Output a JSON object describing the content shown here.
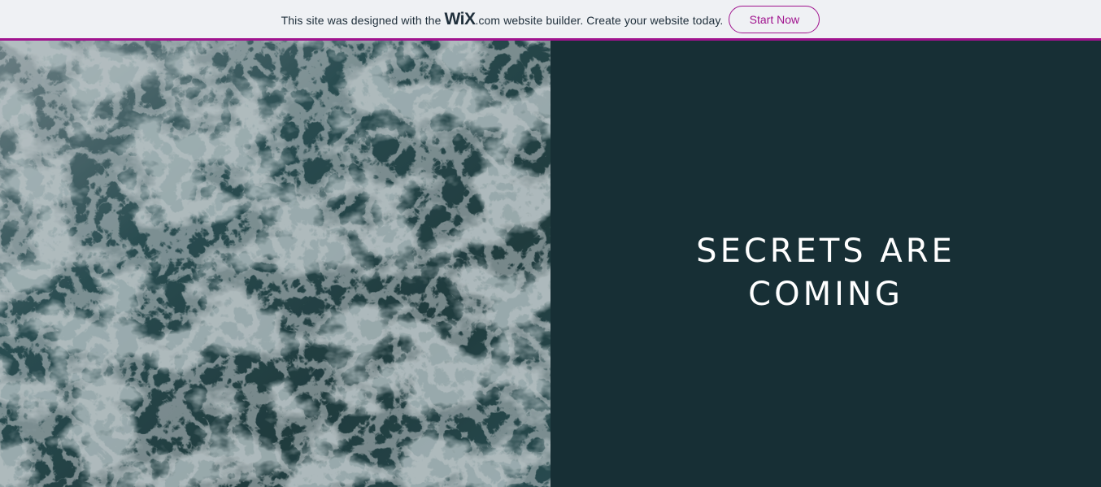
{
  "banner": {
    "text_before": "This site was designed with the",
    "logo_text": "WiX",
    "logo_suffix": ".com",
    "text_after": "website builder. Create your website today.",
    "cta_label": "Start Now",
    "accent_color": "#a0138e"
  },
  "hero": {
    "headline_line1": "SECRETS ARE",
    "headline_line2": "COMING",
    "panel_color": "#172f35",
    "image": "ocean-waves-aerial-photo"
  }
}
